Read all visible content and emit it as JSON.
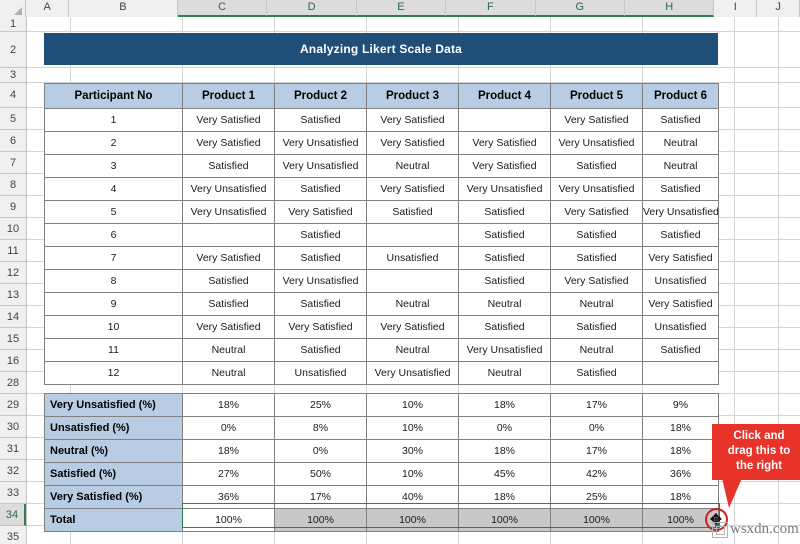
{
  "spreadsheet": {
    "columns": [
      "A",
      "B",
      "C",
      "D",
      "E",
      "F",
      "G",
      "H",
      "I",
      "J"
    ],
    "selected_columns": [
      "C",
      "D",
      "E",
      "F",
      "G",
      "H"
    ],
    "rows": [
      "1",
      "2",
      "3",
      "4",
      "5",
      "6",
      "7",
      "8",
      "9",
      "10",
      "11",
      "12",
      "13",
      "14",
      "15",
      "16",
      "28",
      "29",
      "30",
      "31",
      "32",
      "33",
      "34",
      "35"
    ],
    "selected_row": "34",
    "hidden_rows_note": "17-27"
  },
  "title": {
    "text": "Analyzing Likert Scale Data",
    "fill": "#1f4e79",
    "color": "#ffffff"
  },
  "data_table": {
    "headers": [
      "Participant No",
      "Product 1",
      "Product 2",
      "Product 3",
      "Product 4",
      "Product 5",
      "Product 6"
    ],
    "header_fill": "#b8cce4",
    "rows": [
      [
        "1",
        "Very Satisfied",
        "Satisfied",
        "Very Satisfied",
        "",
        "Very Satisfied",
        "Satisfied"
      ],
      [
        "2",
        "Very Satisfied",
        "Very Unsatisfied",
        "Very Satisfied",
        "Very Satisfied",
        "Very Unsatisfied",
        "Neutral"
      ],
      [
        "3",
        "Satisfied",
        "Very Unsatisfied",
        "Neutral",
        "Very Satisfied",
        "Satisfied",
        "Neutral"
      ],
      [
        "4",
        "Very Unsatisfied",
        "Satisfied",
        "Very Satisfied",
        "Very Unsatisfied",
        "Very Unsatisfied",
        "Satisfied"
      ],
      [
        "5",
        "Very Unsatisfied",
        "Very Satisfied",
        "Satisfied",
        "Satisfied",
        "Very Satisfied",
        "Very Unsatisfied"
      ],
      [
        "6",
        "",
        "Satisfied",
        "",
        "Satisfied",
        "Satisfied",
        "Satisfied"
      ],
      [
        "7",
        "Very Satisfied",
        "Satisfied",
        "Unsatisfied",
        "Satisfied",
        "Satisfied",
        "Very Satisfied"
      ],
      [
        "8",
        "Satisfied",
        "Very Unsatisfied",
        "",
        "Satisfied",
        "Very Satisfied",
        "Unsatisfied"
      ],
      [
        "9",
        "Satisfied",
        "Satisfied",
        "Neutral",
        "Neutral",
        "Neutral",
        "Very Satisfied"
      ],
      [
        "10",
        "Very Satisfied",
        "Very Satisfied",
        "Very Satisfied",
        "Satisfied",
        "Satisfied",
        "Unsatisfied"
      ],
      [
        "11",
        "Neutral",
        "Satisfied",
        "Neutral",
        "Very Unsatisfied",
        "Neutral",
        "Satisfied"
      ],
      [
        "12",
        "Neutral",
        "Unsatisfied",
        "Very Unsatisfied",
        "Neutral",
        "Satisfied",
        ""
      ]
    ]
  },
  "summary_table": {
    "label_fill": "#b8cce4",
    "selected_fill": "#c8c8c8",
    "rows": [
      {
        "label": "Very Unsatisfied (%)",
        "values": [
          "18%",
          "25%",
          "10%",
          "18%",
          "17%",
          "9%"
        ]
      },
      {
        "label": "Unsatisfied (%)",
        "values": [
          "0%",
          "8%",
          "10%",
          "0%",
          "0%",
          "18%"
        ]
      },
      {
        "label": "Neutral (%)",
        "values": [
          "18%",
          "0%",
          "30%",
          "18%",
          "17%",
          "18%"
        ]
      },
      {
        "label": "Satisfied (%)",
        "values": [
          "27%",
          "50%",
          "10%",
          "45%",
          "42%",
          "36%"
        ]
      },
      {
        "label": "Very Satisfied (%)",
        "values": [
          "36%",
          "17%",
          "40%",
          "18%",
          "25%",
          "18%"
        ]
      },
      {
        "label": "Total",
        "values": [
          "100%",
          "100%",
          "100%",
          "100%",
          "100%",
          "100%"
        ]
      }
    ]
  },
  "callout": {
    "line1": "Click and",
    "line2": "drag this to",
    "line3": "the right",
    "fill": "#e8332a",
    "color": "#ffffff"
  },
  "watermark": {
    "text": "wsxdn.com"
  },
  "accent": {
    "selection_green": "#2e7d4f",
    "grid_line": "#d4d4d4",
    "table_border": "#808080"
  }
}
